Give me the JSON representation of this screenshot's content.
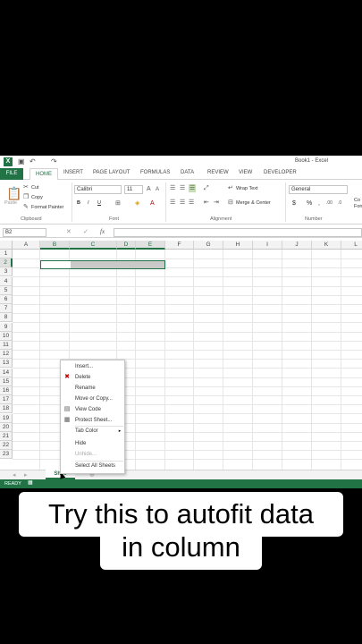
{
  "window": {
    "title": "Book1 - Excel",
    "app_icon": "X",
    "qat": [
      "save-icon",
      "undo-icon",
      "redo-icon"
    ]
  },
  "tabs": {
    "file": "FILE",
    "items": [
      "HOME",
      "INSERT",
      "PAGE LAYOUT",
      "FORMULAS",
      "DATA",
      "REVIEW",
      "VIEW",
      "DEVELOPER"
    ]
  },
  "ribbon": {
    "clipboard": {
      "paste": "Paste",
      "cut": "Cut",
      "copy": "Copy",
      "format_painter": "Format Painter",
      "label": "Clipboard"
    },
    "font": {
      "name": "Calibri",
      "size": "11",
      "label": "Font",
      "bold": "B",
      "italic": "I",
      "underline": "U"
    },
    "alignment": {
      "wrap": "Wrap Text",
      "merge": "Merge & Center",
      "label": "Alignment"
    },
    "number": {
      "format": "General",
      "currency": "$",
      "percent": "%",
      "label": "Number",
      "extra": "Co Fon"
    }
  },
  "formula_bar": {
    "name_box": "B2",
    "fx": "fx",
    "cancel": "✕",
    "enter": "✓"
  },
  "columns": [
    "A",
    "B",
    "C",
    "D",
    "E",
    "F",
    "G",
    "H",
    "I",
    "J",
    "K",
    "L"
  ],
  "rows": [
    "1",
    "2",
    "3",
    "4",
    "5",
    "6",
    "7",
    "8",
    "9",
    "10",
    "11",
    "12",
    "13",
    "14",
    "15",
    "16",
    "17",
    "18",
    "19",
    "20",
    "21",
    "22",
    "23"
  ],
  "context_menu": {
    "items": [
      {
        "label": "Insert...",
        "disabled": false
      },
      {
        "label": "Delete",
        "disabled": false
      },
      {
        "label": "Rename",
        "disabled": false
      },
      {
        "label": "Move or Copy...",
        "disabled": false
      },
      {
        "label": "View Code",
        "disabled": false
      },
      {
        "label": "Protect Sheet...",
        "disabled": false
      },
      {
        "label": "Tab Color",
        "disabled": false
      },
      {
        "label": "Hide",
        "disabled": false
      },
      {
        "label": "Unhide...",
        "disabled": true
      },
      {
        "label": "Select All Sheets",
        "disabled": false
      }
    ]
  },
  "sheet_tab": {
    "label": "Shee"
  },
  "status": {
    "text": "READY"
  },
  "caption": {
    "line1": "Try this to autofit data",
    "line2": "in column"
  },
  "colors": {
    "excel_green": "#217346"
  }
}
